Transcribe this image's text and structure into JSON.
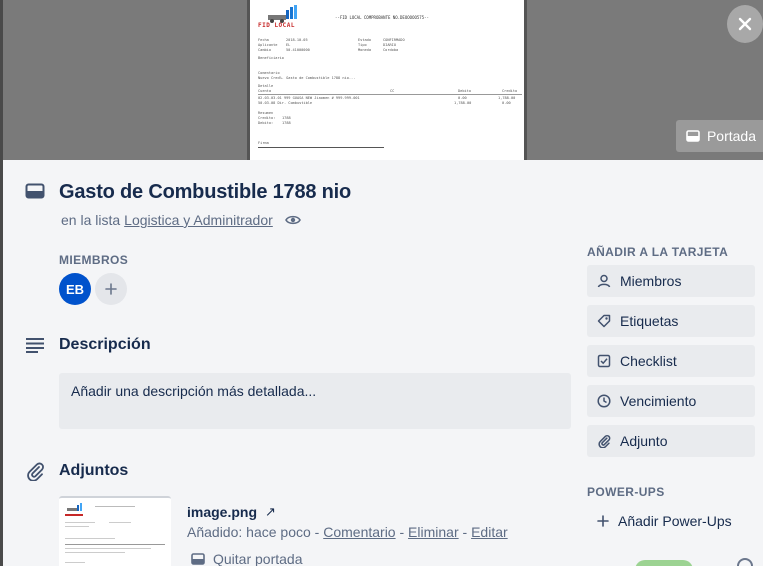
{
  "cover": {
    "document": {
      "brand": "FID LOCAL",
      "header": "--FID LOCAL COMPROBANTE NO.DEOOOOO575--",
      "fields_left": [
        "Fecha",
        "Aplicante",
        "Cambio"
      ],
      "values_left": [
        "2018-10-05",
        "EL",
        "50.41000000"
      ],
      "fields_mid": [
        "Estado",
        "Tipo",
        "Moneda"
      ],
      "values_mid": [
        "CONFIRMADO",
        "DIARIO",
        "Cordoba"
      ],
      "beneficiario": "Beneficiario",
      "comentario_label": "Comentario",
      "comentario": "Nuevo Cred%. Gasto de Combustible 1788 nio...",
      "detalle_label": "Detalle",
      "detalle_cols": [
        "Cuenta",
        "CC",
        "Debito",
        "Credito"
      ],
      "detalle_rows": [
        [
          "02-03-03-01 999 GUASA NEW Jiaomen # 999-999-001",
          "0.00",
          "1,788.00"
        ],
        [
          "50-03-08 Dir. Combustible",
          "1,788.00",
          "0.00"
        ]
      ],
      "resumen_label": "Resumen",
      "resumen_rows": [
        [
          "Credito:",
          "1788"
        ],
        [
          "Debito:",
          "1788"
        ]
      ],
      "firma": "Firma"
    },
    "portada_label": "Portada"
  },
  "card": {
    "title": "Gasto de Combustible 1788 nio",
    "in_list_prefix": "en la lista",
    "list_name": "Logistica y Adminitrador",
    "members_label": "MIEMBROS",
    "member_initials": "EB",
    "description_title": "Descripción",
    "description_placeholder": "Añadir una descripción más detallada...",
    "attachments_title": "Adjuntos",
    "attachment": {
      "name": "image.png",
      "arrow": "↗",
      "added_prefix": "Añadido: hace poco - ",
      "comment": "Comentario",
      "sep": " - ",
      "delete": "Eliminar",
      "edit": "Editar",
      "remove_cover": "Quitar portada"
    }
  },
  "sidebar": {
    "add_label": "AÑADIR A LA TARJETA",
    "buttons": [
      {
        "label": "Miembros",
        "icon": "person-icon"
      },
      {
        "label": "Etiquetas",
        "icon": "tag-icon"
      },
      {
        "label": "Checklist",
        "icon": "checkbox-icon"
      },
      {
        "label": "Vencimiento",
        "icon": "clock-icon"
      },
      {
        "label": "Adjunto",
        "icon": "paperclip-icon"
      }
    ],
    "powerups_label": "POWER-UPS",
    "add_powerups": "Añadir Power-Ups"
  },
  "colors": {
    "avatar": "#0052cc",
    "panel": "#f4f5f7",
    "button": "#e9ebee",
    "text": "#172b4d",
    "muted": "#5e6c84"
  }
}
